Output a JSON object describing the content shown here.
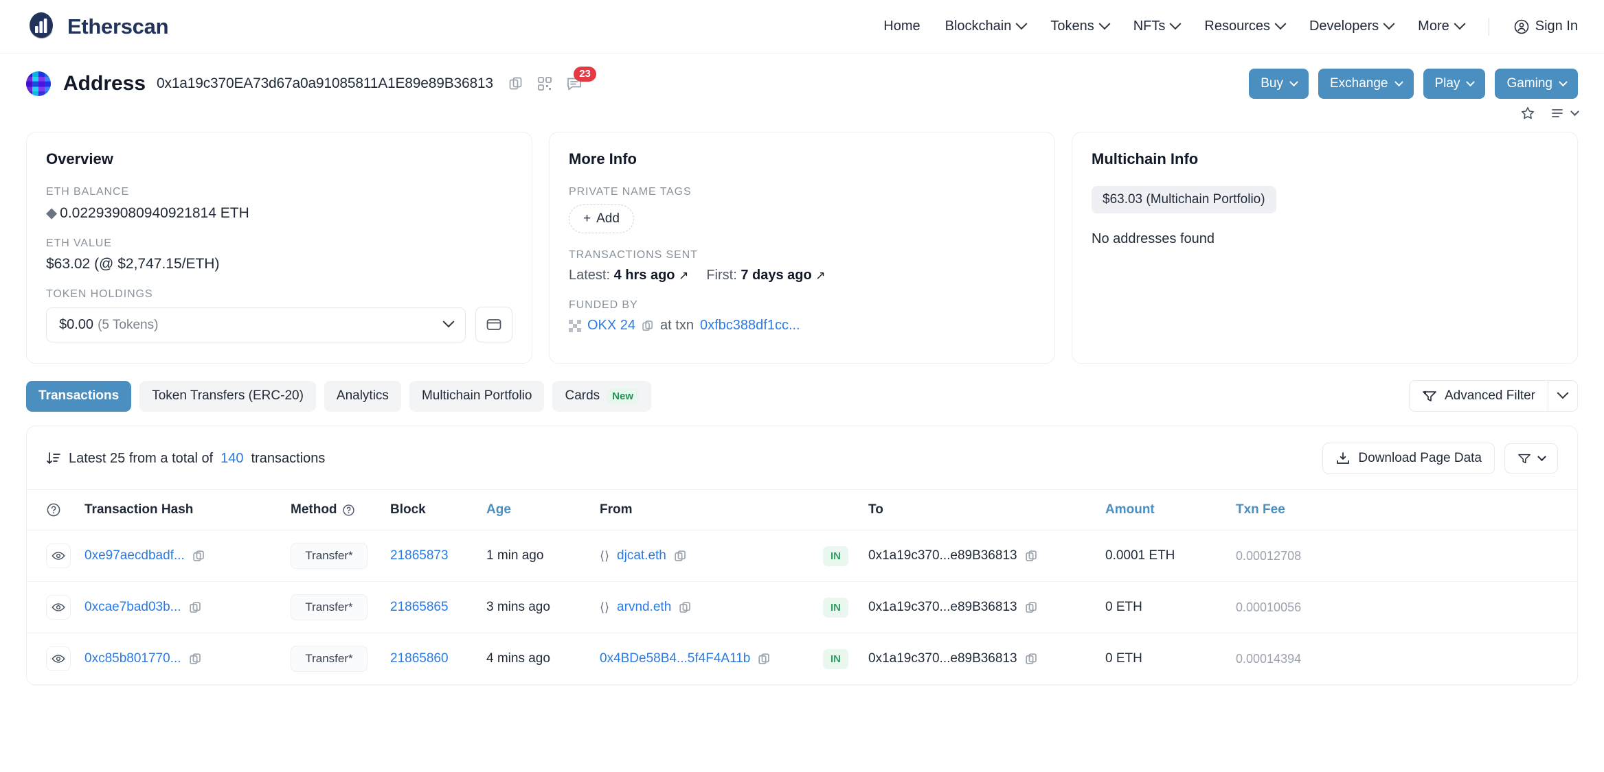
{
  "nav": {
    "brand": "Etherscan",
    "links": [
      {
        "label": "Home",
        "caret": false
      },
      {
        "label": "Blockchain",
        "caret": true
      },
      {
        "label": "Tokens",
        "caret": true
      },
      {
        "label": "NFTs",
        "caret": true
      },
      {
        "label": "Resources",
        "caret": true
      },
      {
        "label": "Developers",
        "caret": true
      },
      {
        "label": "More",
        "caret": true
      }
    ],
    "sign_in": "Sign In"
  },
  "header": {
    "title": "Address",
    "hash": "0x1a19c370EA73d67a0a91085811A1E89e89B36813",
    "comment_count": "23",
    "actions": [
      {
        "label": "Buy"
      },
      {
        "label": "Exchange"
      },
      {
        "label": "Play"
      },
      {
        "label": "Gaming"
      }
    ]
  },
  "overview": {
    "title": "Overview",
    "eth_balance_label": "ETH BALANCE",
    "eth_balance": "0.022939080940921814 ETH",
    "eth_value_label": "ETH VALUE",
    "eth_value": "$63.02 (@ $2,747.15/ETH)",
    "token_holdings_label": "TOKEN HOLDINGS",
    "token_value": "$0.00",
    "token_count": "(5 Tokens)"
  },
  "more_info": {
    "title": "More Info",
    "private_name_tags_label": "PRIVATE NAME TAGS",
    "add_label": "Add",
    "transactions_sent_label": "TRANSACTIONS SENT",
    "latest_prefix": "Latest:",
    "latest_value": "4 hrs ago",
    "first_prefix": "First:",
    "first_value": "7 days ago",
    "funded_by_label": "FUNDED BY",
    "funded_by_name": "OKX 24",
    "funded_at_text": "at txn",
    "funded_txn": "0xfbc388df1cc..."
  },
  "multichain": {
    "title": "Multichain Info",
    "portfolio_badge": "$63.03 (Multichain Portfolio)",
    "empty_text": "No addresses found"
  },
  "tabs": [
    {
      "label": "Transactions",
      "active": true,
      "badge": ""
    },
    {
      "label": "Token Transfers (ERC-20)",
      "active": false,
      "badge": ""
    },
    {
      "label": "Analytics",
      "active": false,
      "badge": ""
    },
    {
      "label": "Multichain Portfolio",
      "active": false,
      "badge": ""
    },
    {
      "label": "Cards",
      "active": false,
      "badge": "New"
    }
  ],
  "advanced_filter_label": "Advanced Filter",
  "table": {
    "summary_prefix": "Latest 25 from a total of",
    "summary_count": "140",
    "summary_suffix": "transactions",
    "download_label": "Download Page Data",
    "columns": {
      "hash": "Transaction Hash",
      "method": "Method",
      "block": "Block",
      "age": "Age",
      "from": "From",
      "to": "To",
      "amount": "Amount",
      "fee": "Txn Fee"
    },
    "rows": [
      {
        "hash": "0xe97aecdbadf...",
        "method": "Transfer*",
        "block": "21865873",
        "age": "1 min ago",
        "from": "djcat.eth",
        "from_is_ens": true,
        "direction": "IN",
        "to": "0x1a19c370...e89B36813",
        "amount": "0.0001 ETH",
        "fee": "0.00012708"
      },
      {
        "hash": "0xcae7bad03b...",
        "method": "Transfer*",
        "block": "21865865",
        "age": "3 mins ago",
        "from": "arvnd.eth",
        "from_is_ens": true,
        "direction": "IN",
        "to": "0x1a19c370...e89B36813",
        "amount": "0 ETH",
        "fee": "0.00010056"
      },
      {
        "hash": "0xc85b801770...",
        "method": "Transfer*",
        "block": "21865860",
        "age": "4 mins ago",
        "from": "0x4BDe58B4...5f4F4A11b",
        "from_is_ens": false,
        "direction": "IN",
        "to": "0x1a19c370...e89B36813",
        "amount": "0 ETH",
        "fee": "0.00014394"
      }
    ]
  },
  "colors": {
    "brand_navy": "#21325b",
    "accent_blue": "#4a8fc0",
    "link_blue": "#2a7ae2",
    "badge_red": "#e53946",
    "in_green": "#2e9e63"
  }
}
